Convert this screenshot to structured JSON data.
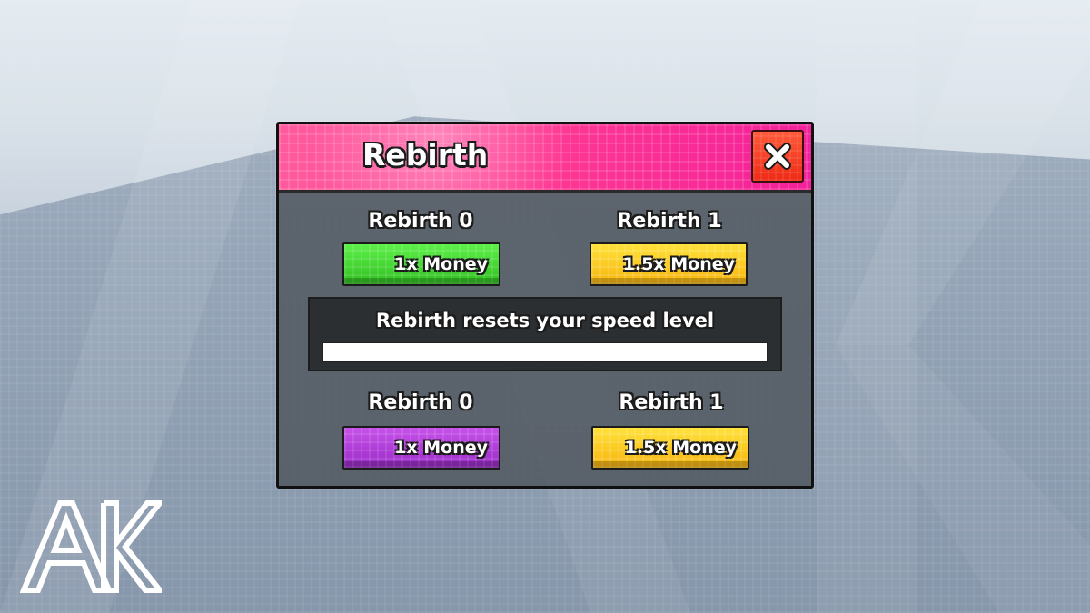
{
  "panel": {
    "title": "Rebirth",
    "close_label": "×"
  },
  "top_row": {
    "left": {
      "label": "Rebirth 0",
      "reward": "1x Money"
    },
    "right": {
      "label": "Rebirth 1",
      "reward": "1.5x Money"
    }
  },
  "info": {
    "text": "Rebirth resets your speed level",
    "progress": 1.0
  },
  "bottom_row": {
    "left": {
      "label": "Rebirth 0",
      "reward": "1x Money"
    },
    "right": {
      "label": "Rebirth 1",
      "reward": "1.5x Money"
    }
  },
  "logo": {
    "text": "AK"
  },
  "colors": {
    "header": "#ff3a92",
    "close": "#ee2b16",
    "green": "#2fbf20",
    "yellow": "#f7b40d",
    "purple": "#9a2bc8"
  },
  "icons": {
    "close": "close-icon"
  }
}
